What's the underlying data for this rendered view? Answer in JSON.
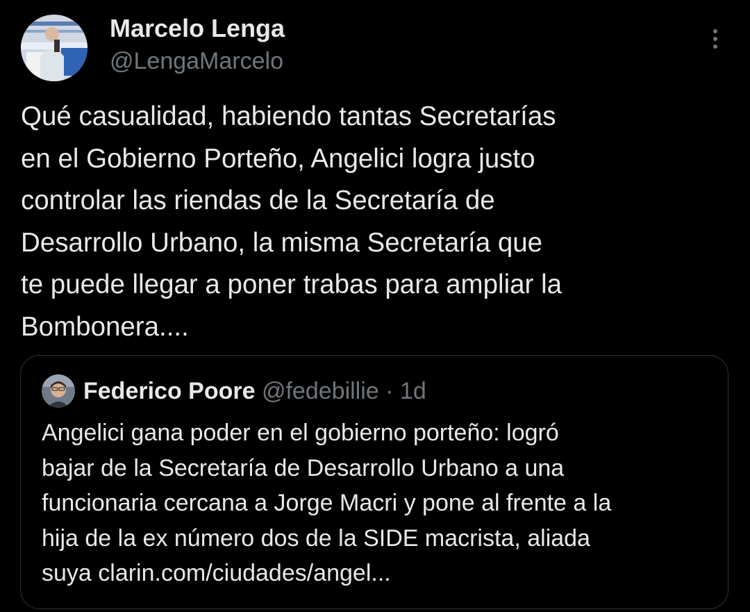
{
  "tweet": {
    "author": {
      "display_name": "Marcelo Lenga",
      "handle": "@LengaMarcelo"
    },
    "text_lines": [
      "Qué casualidad, habiendo tantas Secretarías",
      "en el Gobierno Porteño, Angelici logra justo",
      "controlar las riendas de la Secretaría de",
      "Desarrollo Urbano, la misma Secretaría que",
      "te puede llegar a poner trabas para ampliar la",
      "Bombonera...."
    ],
    "more_icon": "more-vertical-icon"
  },
  "quoted_tweet": {
    "author": {
      "display_name": "Federico Poore",
      "handle": "@fedebillie"
    },
    "separator": "·",
    "time": "1d",
    "text_lines": [
      "Angelici gana poder en el gobierno porteño: logró",
      "bajar de la Secretaría de Desarrollo Urbano a una",
      "funcionaria cercana a Jorge Macri y pone al frente a la",
      "hija de la ex número dos de la SIDE macrista, aliada",
      "suya clarin.com/ciudades/angel..."
    ]
  },
  "colors": {
    "background": "#000000",
    "primary_text": "#e7e9ea",
    "secondary_text": "#71767b",
    "border": "#2f3336"
  }
}
